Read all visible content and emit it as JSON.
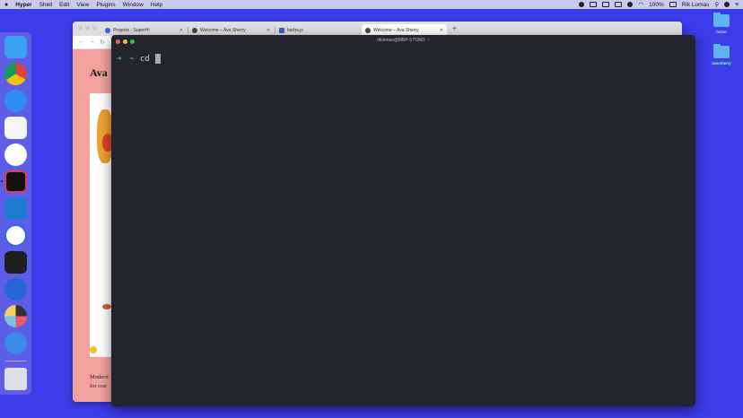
{
  "menubar": {
    "app_name": "Hyper",
    "menus": [
      "Shell",
      "Edit",
      "View",
      "Plugins",
      "Window",
      "Help"
    ],
    "battery": "100%",
    "user": "Rik Lomas"
  },
  "desktop": {
    "icons": [
      {
        "label": "home"
      },
      {
        "label": "ava-sherry"
      }
    ]
  },
  "browser": {
    "tabs": [
      {
        "title": "Projects - SuperHi",
        "active": false
      },
      {
        "title": "Welcome – Ava Sherry",
        "active": false
      },
      {
        "title": "barba.js",
        "active": false
      },
      {
        "title": "Welcome – Ava Sherry",
        "active": true
      }
    ],
    "new_tab": "+",
    "site_title": "Ava",
    "body_line1": "Modern",
    "body_line2": "for con"
  },
  "terminal": {
    "title": "riklomas@MBP-575360: ~",
    "prompt_arrow": "➜",
    "cwd": "~",
    "command": "cd"
  },
  "colors": {
    "desktop": "#3c3cea",
    "terminal_bg": "#23252e",
    "browser_bg": "#f1a29f",
    "prompt_arrow": "#4fcf6a",
    "cwd": "#6fd0e0"
  }
}
